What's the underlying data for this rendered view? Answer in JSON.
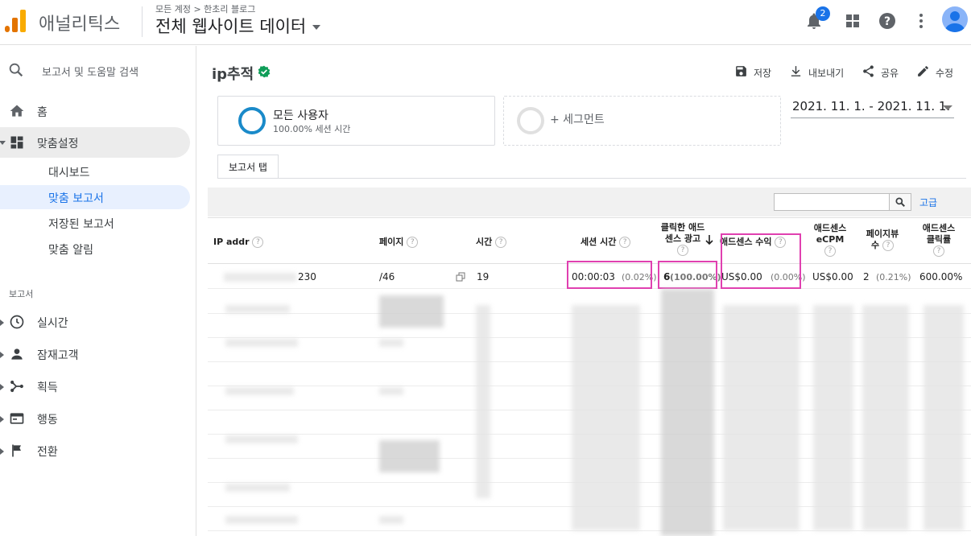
{
  "header": {
    "app_name": "애널리틱스",
    "breadcrumb": "모든 계정 > 한초리 블로그",
    "view_title": "전체 웹사이트 데이터",
    "notifications": "2"
  },
  "sidebar": {
    "search_placeholder": "보고서 및 도움말 검색",
    "home": "홈",
    "custom": "맞춤설정",
    "sub": [
      "대시보드",
      "맞춤 보고서",
      "저장된 보고서",
      "맞춤 알림"
    ],
    "section": "보고서",
    "reports": [
      "실시간",
      "잠재고객",
      "획득",
      "행동",
      "전환"
    ]
  },
  "report": {
    "title": "ip추적",
    "actions": {
      "save": "저장",
      "export": "내보내기",
      "share": "공유",
      "edit": "수정"
    },
    "segment": {
      "name": "모든 사용자",
      "sub": "100.00% 세션 시간"
    },
    "add_segment": "+ 세그먼트",
    "date_range": "2021. 11. 1. - 2021. 11. 1.",
    "tab": "보고서 탭",
    "advanced": "고급"
  },
  "table": {
    "headers": {
      "ip": "IP addr",
      "page": "페이지",
      "time": "시간",
      "session": "세션 시간",
      "clicked": "클릭한 애드센스 광고",
      "revenue": "애드센스 수익",
      "ecpm": "애드센스 eCPM",
      "pageviews": "페이지뷰 수",
      "ctr": "애드센스 클릭률"
    },
    "first_row": {
      "ip": "230",
      "page": "/46",
      "time": "19",
      "session": "00:00:03",
      "session_pct": "(0.02%)",
      "clicks": "6",
      "clicks_pct": "(100.00%)",
      "revenue": "US$0.00",
      "revenue_pct": "(0.00%)",
      "ecpm": "US$0.00",
      "pageviews": "2",
      "pageviews_pct": "(0.21%)",
      "ctr": "600.00%"
    }
  },
  "colors": {
    "accent": "#1a73e8",
    "highlight": "#e040b0",
    "segment_ring": "#1a8ac9"
  }
}
